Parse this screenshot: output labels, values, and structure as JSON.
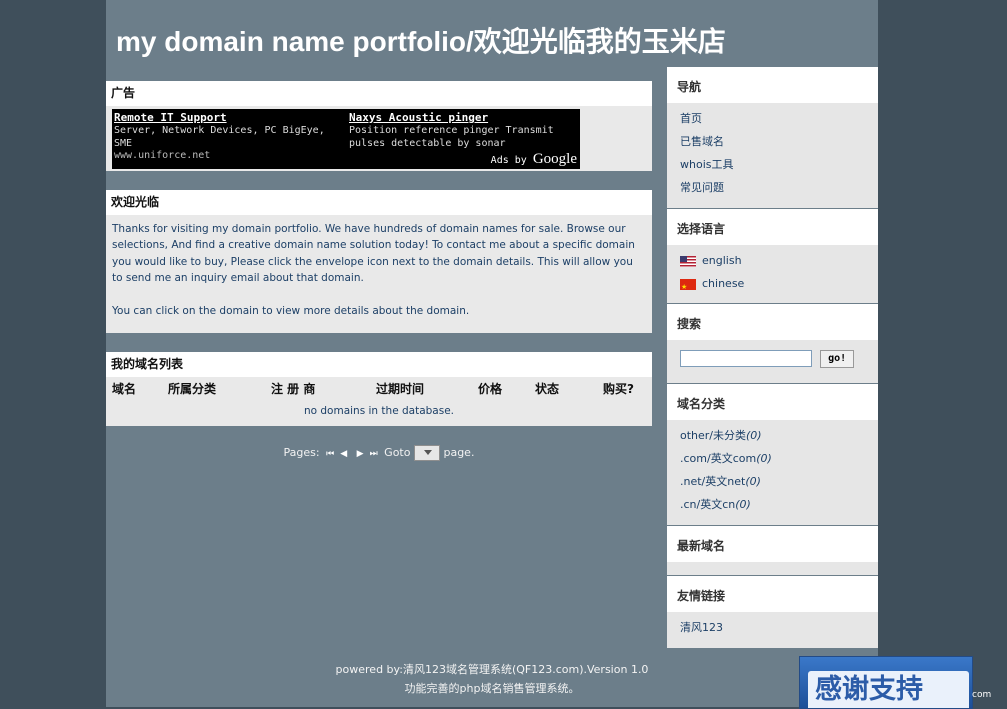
{
  "header": {
    "title": "my domain name portfolio/欢迎光临我的玉米店"
  },
  "ads_box": {
    "heading": "广告",
    "ads": [
      {
        "title": "Remote IT Support",
        "lines": [
          "Server, Network Devices, PC BigEye, SME"
        ],
        "url": "www.uniforce.net"
      },
      {
        "title": "Naxys Acoustic pinger",
        "lines": [
          "Position reference pinger Transmit",
          "pulses detectable by sonar"
        ],
        "url": ""
      }
    ],
    "ads_by_label": "Ads by",
    "ads_by_brand": "Google"
  },
  "welcome_box": {
    "heading": "欢迎光临",
    "paragraph1": "Thanks for visiting my domain portfolio. We have hundreds of domain names for sale. Browse our selections, And find a creative domain name solution today! To contact me about a specific domain you would like to buy, Please click the envelope icon next to the domain details. This will allow you to send me an inquiry email about that domain.",
    "paragraph2": "You can click on the domain to view more details about the domain."
  },
  "domain_list": {
    "heading": "我的域名列表",
    "columns": [
      "域名",
      "所属分类",
      "注 册 商",
      "过期时间",
      "价格",
      "状态",
      "购买?"
    ],
    "empty_message": "no domains in the database."
  },
  "pager": {
    "pages_label": "Pages:",
    "goto_label": "Goto",
    "page_label": "page."
  },
  "sidebar": {
    "nav": {
      "heading": "导航",
      "items": [
        "首页",
        "已售域名",
        "whois工具",
        "常见问题"
      ]
    },
    "language": {
      "heading": "选择语言",
      "items": [
        "english",
        "chinese"
      ]
    },
    "search": {
      "heading": "搜索",
      "button_label": "go!",
      "input_value": ""
    },
    "categories": {
      "heading": "域名分类",
      "items": [
        {
          "name": "other/未分类",
          "count": "(0)"
        },
        {
          "name": ".com/英文com",
          "count": "(0)"
        },
        {
          "name": ".net/英文net",
          "count": "(0)"
        },
        {
          "name": ".cn/英文cn",
          "count": "(0)"
        }
      ]
    },
    "latest": {
      "heading": "最新域名"
    },
    "links": {
      "heading": "友情链接",
      "items": [
        "清风123"
      ]
    }
  },
  "footer": {
    "line1": "powered by:清风123域名管理系统(QF123.com).Version 1.0",
    "line2": "功能完善的php域名销售管理系统。"
  },
  "thanks_banner": {
    "text": "感谢支持"
  },
  "corner_text": "com",
  "colors": {
    "page_bg": "#6c7e8a",
    "outer_bg": "#3f4f5b",
    "link": "#1c3f66",
    "panel": "#e9e9e9"
  }
}
